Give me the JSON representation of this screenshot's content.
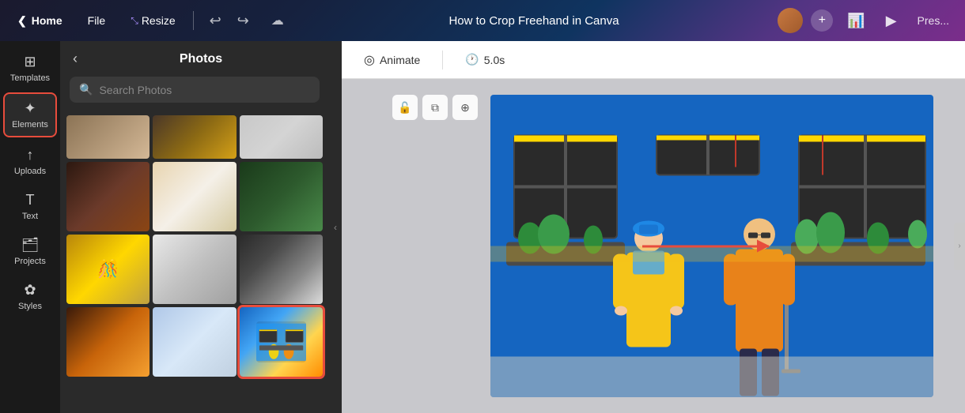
{
  "topbar": {
    "home_label": "Home",
    "file_label": "File",
    "resize_label": "Resize",
    "title": "How to Crop Freehand in Canva",
    "present_label": "Pres..."
  },
  "panel": {
    "title": "Photos",
    "search_placeholder": "Search Photos"
  },
  "toolbar": {
    "animate_label": "Animate",
    "duration_label": "5.0s"
  },
  "sidebar": {
    "items": [
      {
        "label": "Templates",
        "icon": "⊞"
      },
      {
        "label": "Elements",
        "icon": "✦"
      },
      {
        "label": "Uploads",
        "icon": "↑"
      },
      {
        "label": "Text",
        "icon": "T"
      },
      {
        "label": "Projects",
        "icon": "📁"
      },
      {
        "label": "Styles",
        "icon": "✿"
      }
    ]
  }
}
